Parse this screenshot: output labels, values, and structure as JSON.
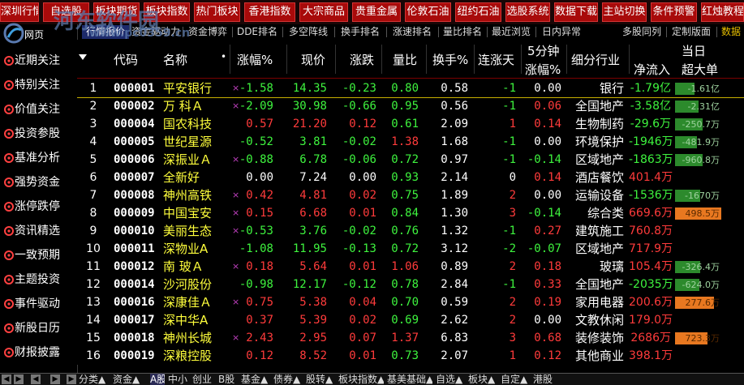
{
  "toolbar": {
    "buttons": [
      "深圳行情",
      "自选股",
      "板块期货",
      "板块指数",
      "热门板块",
      "香港指数",
      "大宗商品",
      "贵重金属",
      "伦敦石油",
      "纽约石油",
      "选股系统",
      "数据下载",
      "主站切换",
      "条件预警",
      "红烛教程"
    ]
  },
  "subtabs": {
    "items": [
      "行情报价",
      "资金驱动力",
      "资金博弈",
      "DDE排名",
      "多空阵线",
      "换手排名",
      "涨速排名",
      "量比排名",
      "最近浏览",
      "日内异常",
      "多股同列",
      "定制版面",
      "数据"
    ],
    "active_index": 0
  },
  "sidebar": {
    "logo": "河东软件园",
    "logo_sub": "网页",
    "items": [
      {
        "label": "近期关注",
        "icon": "clock-icon",
        "color": "#ff4040"
      },
      {
        "label": "特别关注",
        "icon": "star-icon",
        "color": "#ff4040"
      },
      {
        "label": "价值关注",
        "icon": "gem-icon",
        "color": "#ff4040"
      },
      {
        "label": "投资参股",
        "icon": "handshake-icon",
        "color": "#ff4040"
      },
      {
        "label": "基准分析",
        "icon": "target-icon",
        "color": "#ff4040"
      },
      {
        "label": "强势资金",
        "icon": "chart-icon",
        "color": "#ff4040"
      },
      {
        "label": "涨停跌停",
        "icon": "arrows-icon",
        "color": "#ff4040"
      },
      {
        "label": "资讯精选",
        "icon": "news-icon",
        "color": "#ff4040"
      },
      {
        "label": "一致预期",
        "icon": "forecast-icon",
        "color": "#ff4040"
      },
      {
        "label": "主题投资",
        "icon": "theme-icon",
        "color": "#ff4040"
      },
      {
        "label": "事件驱动",
        "icon": "event-icon",
        "color": "#ff4040"
      },
      {
        "label": "新股日历",
        "icon": "calendar-icon",
        "color": "#ff4040"
      },
      {
        "label": "财报披露",
        "icon": "report-icon",
        "color": "#ff4040"
      }
    ]
  },
  "watermark": {
    "url": "www.pc0359.cn"
  },
  "table": {
    "headers": {
      "code": "代码",
      "name": "名称",
      "change_pct": "涨幅%",
      "price": "现价",
      "change": "涨跌",
      "volume_ratio": "量比",
      "turnover": "换手%",
      "consecutive_up": "连涨天",
      "five_min_top": "5分钟",
      "five_min_bottom": "涨幅%",
      "industry": "细分行业",
      "day_top": "当日",
      "net_inflow": "净流入",
      "super_large": "超大单"
    },
    "rows": [
      {
        "idx": "1",
        "code": "000001",
        "name": "平安银行",
        "mark": "×",
        "chg_pct": "-1.58",
        "price": "14.35",
        "chg": "-0.23",
        "vr": "0.80",
        "turnover": "0.58",
        "up_days": "-1",
        "m5": "0.00",
        "industry": "银行",
        "inflow": "-1.79亿",
        "inflow_dir": "down",
        "bar_dir": "down",
        "bar_val": "-1.61亿",
        "bar_frac": 0.42
      },
      {
        "idx": "2",
        "code": "000002",
        "name": "万 科Ａ",
        "mark": "×",
        "chg_pct": "-2.09",
        "price": "30.98",
        "chg": "-0.66",
        "vr": "0.95",
        "turnover": "0.56",
        "up_days": "-1",
        "m5": "0.06",
        "industry": "全国地产",
        "inflow": "-3.58亿",
        "inflow_dir": "down",
        "bar_dir": "down",
        "bar_val": "-2.31亿",
        "bar_frac": 0.5
      },
      {
        "idx": "3",
        "code": "000004",
        "name": "国农科技",
        "mark": "",
        "chg_pct": "0.57",
        "price": "21.20",
        "chg": "0.12",
        "vr": "0.61",
        "turnover": "2.09",
        "up_days": "1",
        "m5": "0.14",
        "industry": "生物制药",
        "inflow": "-29.6万",
        "inflow_dir": "down",
        "bar_dir": "down",
        "bar_val": "-250.7万",
        "bar_frac": 0.6
      },
      {
        "idx": "4",
        "code": "000005",
        "name": "世纪星源",
        "mark": "",
        "chg_pct": "-0.52",
        "price": "3.81",
        "chg": "-0.02",
        "vr": "1.38",
        "turnover": "1.68",
        "up_days": "-1",
        "m5": "0.00",
        "industry": "环境保护",
        "inflow": "-1946万",
        "inflow_dir": "down",
        "bar_dir": "down",
        "bar_val": "-481.9万",
        "bar_frac": 0.48
      },
      {
        "idx": "5",
        "code": "000006",
        "name": "深振业Ａ",
        "mark": "×",
        "chg_pct": "-0.88",
        "price": "6.78",
        "chg": "-0.06",
        "vr": "0.72",
        "turnover": "0.97",
        "up_days": "-1",
        "m5": "-0.14",
        "industry": "区域地产",
        "inflow": "-1863万",
        "inflow_dir": "down",
        "bar_dir": "down",
        "bar_val": "-960.8万",
        "bar_frac": 0.6
      },
      {
        "idx": "6",
        "code": "000007",
        "name": "全新好",
        "mark": "",
        "chg_pct": "0.00",
        "price": "7.24",
        "chg": "0.00",
        "vr": "0.93",
        "turnover": "2.14",
        "up_days": "0",
        "m5": "0.14",
        "industry": "酒店餐饮",
        "inflow": "401.4万",
        "inflow_dir": "up",
        "bar_dir": "none",
        "bar_val": "",
        "bar_frac": 0
      },
      {
        "idx": "7",
        "code": "000008",
        "name": "神州高铁",
        "mark": "×",
        "chg_pct": "0.42",
        "price": "4.81",
        "chg": "0.02",
        "vr": "0.75",
        "turnover": "1.89",
        "up_days": "2",
        "m5": "0.00",
        "industry": "运输设备",
        "inflow": "-1536万",
        "inflow_dir": "down",
        "bar_dir": "down",
        "bar_val": "-1670万",
        "bar_frac": 0.55
      },
      {
        "idx": "8",
        "code": "000009",
        "name": "中国宝安",
        "mark": "×",
        "chg_pct": "0.15",
        "price": "6.68",
        "chg": "0.01",
        "vr": "0.84",
        "turnover": "1.30",
        "up_days": "3",
        "m5": "-0.14",
        "industry": "综合类",
        "inflow": "669.6万",
        "inflow_dir": "up",
        "bar_dir": "up",
        "bar_val": "498.5万",
        "bar_frac": 1.0
      },
      {
        "idx": "9",
        "code": "000010",
        "name": "美丽生态",
        "mark": "×",
        "chg_pct": "-0.53",
        "price": "3.76",
        "chg": "-0.02",
        "vr": "0.76",
        "turnover": "1.32",
        "up_days": "-1",
        "m5": "0.27",
        "industry": "建筑施工",
        "inflow": "760.8万",
        "inflow_dir": "up",
        "bar_dir": "none",
        "bar_val": "",
        "bar_frac": 0
      },
      {
        "idx": "10",
        "code": "000011",
        "name": "深物业A",
        "mark": "",
        "chg_pct": "-1.08",
        "price": "11.95",
        "chg": "-0.13",
        "vr": "0.72",
        "turnover": "3.12",
        "up_days": "-2",
        "m5": "-0.07",
        "industry": "区域地产",
        "inflow": "717.9万",
        "inflow_dir": "up",
        "bar_dir": "none",
        "bar_val": "",
        "bar_frac": 0
      },
      {
        "idx": "11",
        "code": "000012",
        "name": "南 玻Ａ",
        "mark": "×",
        "chg_pct": "0.18",
        "price": "5.64",
        "chg": "0.01",
        "vr": "1.06",
        "turnover": "0.89",
        "up_days": "2",
        "m5": "0.18",
        "industry": "玻璃",
        "inflow": "105.4万",
        "inflow_dir": "up",
        "bar_dir": "down",
        "bar_val": "-326.4万",
        "bar_frac": 0.55
      },
      {
        "idx": "12",
        "code": "000014",
        "name": "沙河股份",
        "mark": "",
        "chg_pct": "-0.98",
        "price": "12.17",
        "chg": "-0.12",
        "vr": "0.78",
        "turnover": "2.84",
        "up_days": "-1",
        "m5": "0.33",
        "industry": "全国地产",
        "inflow": "-2035万",
        "inflow_dir": "down",
        "bar_dir": "down",
        "bar_val": "-624.0万",
        "bar_frac": 0.52
      },
      {
        "idx": "13",
        "code": "000016",
        "name": "深康佳Ａ",
        "mark": "×",
        "chg_pct": "0.75",
        "price": "5.38",
        "chg": "0.04",
        "vr": "0.70",
        "turnover": "0.59",
        "up_days": "2",
        "m5": "0.19",
        "industry": "家用电器",
        "inflow": "200.6万",
        "inflow_dir": "up",
        "bar_dir": "up",
        "bar_val": "277.6万",
        "bar_frac": 0.85
      },
      {
        "idx": "14",
        "code": "000017",
        "name": "深中华A",
        "mark": "",
        "chg_pct": "0.37",
        "price": "5.39",
        "chg": "0.02",
        "vr": "0.69",
        "turnover": "2.62",
        "up_days": "2",
        "m5": "0.00",
        "industry": "文教休闲",
        "inflow": "179.0万",
        "inflow_dir": "up",
        "bar_dir": "none",
        "bar_val": "",
        "bar_frac": 0
      },
      {
        "idx": "15",
        "code": "000018",
        "name": "神州长城",
        "mark": "×",
        "chg_pct": "2.43",
        "price": "2.95",
        "chg": "0.07",
        "vr": "1.37",
        "turnover": "6.83",
        "up_days": "3",
        "m5": "0.68",
        "industry": "装修装饰",
        "inflow": "2686万",
        "inflow_dir": "up",
        "bar_dir": "up",
        "bar_val": "723.3万",
        "bar_frac": 0.7
      },
      {
        "idx": "16",
        "code": "000019",
        "name": "深粮控股",
        "mark": "",
        "chg_pct": "0.12",
        "price": "8.52",
        "chg": "0.01",
        "vr": "0.73",
        "turnover": "2.07",
        "up_days": "1",
        "m5": "0.12",
        "industry": "其他商业",
        "inflow": "398.1万",
        "inflow_dir": "up",
        "bar_dir": "none",
        "bar_val": "",
        "bar_frac": 0
      }
    ]
  },
  "bottombar": {
    "tabs": [
      "分类▲",
      "资金▲",
      "A股",
      "中小",
      "创业",
      "B股",
      "基金▲",
      "债券▲",
      "股转▲",
      "板块指数▲",
      "基美基础▲",
      "自选▲",
      "板块▲",
      "自定▲",
      "港股"
    ],
    "active_index": 2
  },
  "colors": {
    "up": "#ff3b3b",
    "down": "#3ef33e",
    "name": "#ffff3c",
    "bar_up": "#e87820",
    "bar_down": "#2c8a2c"
  }
}
